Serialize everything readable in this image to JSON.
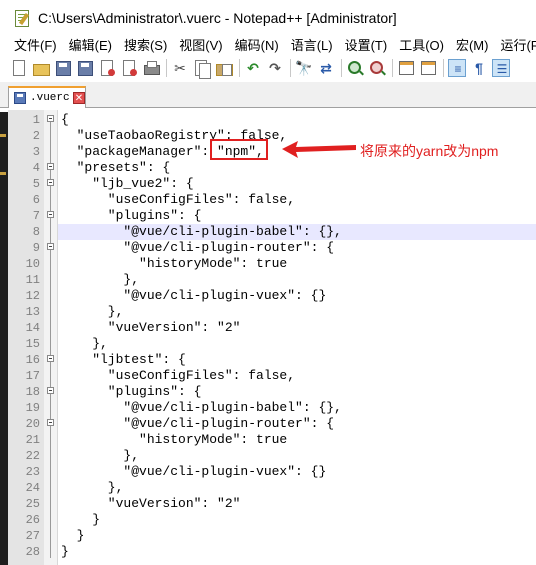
{
  "window": {
    "title": "C:\\Users\\Administrator\\.vuerc - Notepad++ [Administrator]"
  },
  "menu": {
    "items": [
      "文件(F)",
      "编辑(E)",
      "搜索(S)",
      "视图(V)",
      "编码(N)",
      "语言(L)",
      "设置(T)",
      "工具(O)",
      "宏(M)",
      "运行(R)"
    ]
  },
  "toolbar": {
    "icons": [
      "new-file-icon",
      "open-file-icon",
      "save-icon",
      "save-all-icon",
      "close-icon",
      "close-all-icon",
      "print-icon",
      "cut-icon",
      "copy-icon",
      "paste-icon",
      "undo-icon",
      "redo-icon",
      "find-icon",
      "replace-icon",
      "zoom-in-icon",
      "zoom-out-icon",
      "sync-vertical-icon",
      "sync-horizontal-icon",
      "word-wrap-icon",
      "show-all-chars-icon",
      "indent-guide-icon"
    ]
  },
  "tab": {
    "label": ".vuerc"
  },
  "editor": {
    "lines": [
      {
        "n": "1",
        "text": "{"
      },
      {
        "n": "2",
        "text": "  \"useTaobaoRegistry\": false,"
      },
      {
        "n": "3",
        "text": "  \"packageManager\": \"npm\","
      },
      {
        "n": "4",
        "text": "  \"presets\": {"
      },
      {
        "n": "5",
        "text": "    \"ljb_vue2\": {"
      },
      {
        "n": "6",
        "text": "      \"useConfigFiles\": false,"
      },
      {
        "n": "7",
        "text": "      \"plugins\": {"
      },
      {
        "n": "8",
        "text": "        \"@vue/cli-plugin-babel\": {},"
      },
      {
        "n": "9",
        "text": "        \"@vue/cli-plugin-router\": {"
      },
      {
        "n": "10",
        "text": "          \"historyMode\": true"
      },
      {
        "n": "11",
        "text": "        },"
      },
      {
        "n": "12",
        "text": "        \"@vue/cli-plugin-vuex\": {}"
      },
      {
        "n": "13",
        "text": "      },"
      },
      {
        "n": "14",
        "text": "      \"vueVersion\": \"2\""
      },
      {
        "n": "15",
        "text": "    },"
      },
      {
        "n": "16",
        "text": "    \"ljbtest\": {"
      },
      {
        "n": "17",
        "text": "      \"useConfigFiles\": false,"
      },
      {
        "n": "18",
        "text": "      \"plugins\": {"
      },
      {
        "n": "19",
        "text": "        \"@vue/cli-plugin-babel\": {},"
      },
      {
        "n": "20",
        "text": "        \"@vue/cli-plugin-router\": {"
      },
      {
        "n": "21",
        "text": "          \"historyMode\": true"
      },
      {
        "n": "22",
        "text": "        },"
      },
      {
        "n": "23",
        "text": "        \"@vue/cli-plugin-vuex\": {}"
      },
      {
        "n": "24",
        "text": "      },"
      },
      {
        "n": "25",
        "text": "      \"vueVersion\": \"2\""
      },
      {
        "n": "26",
        "text": "    }"
      },
      {
        "n": "27",
        "text": "  }"
      },
      {
        "n": "28",
        "text": "}"
      }
    ],
    "highlighted_line": 8
  },
  "annotation": {
    "text": "将原来的yarn改为npm",
    "color": "#e02020"
  }
}
